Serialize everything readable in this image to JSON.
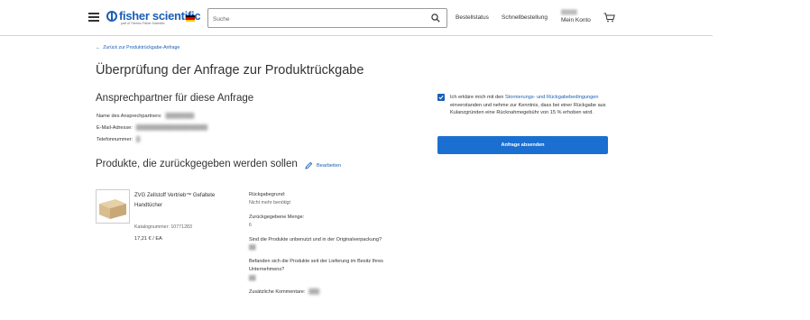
{
  "header": {
    "logo_text": "fisher scientific",
    "logo_sub": "part of Thermo Fisher Scientific",
    "search_placeholder": "Suche",
    "order_status": "Bestellstatus",
    "quick_order": "Schnellbestellung",
    "account_name": "Mein Konto",
    "flag_colors": [
      "#000000",
      "#dd0000",
      "#ffce00"
    ]
  },
  "back_link": "Zurück zur Produktrückgabe-Anfrage",
  "page_title": "Überprüfung der Anfrage zur Produktrückgabe",
  "contact": {
    "heading": "Ansprechpartner für diese Anfrage",
    "name_label": "Name des Ansprechpartners:",
    "email_label": "E-Mail-Adresse:",
    "phone_label": "Telefonnummer:"
  },
  "products": {
    "heading": "Produkte, die zurückgegeben werden sollen",
    "edit_label": "Bearbeiten",
    "item": {
      "name": "ZVG Zellstoff Vertrieb™ Gefaltete Handtücher",
      "catalog": "Katalognummer: 10771283",
      "price": "17,21 € / EA"
    },
    "reason_q": "Rückgabegrund:",
    "reason_a": "Nicht mehr benötigt",
    "qty_q": "Zurückgegebene Menge:",
    "qty_a": "6",
    "unused_q": "Sind die Produkte unbenutzt und in der Originalverpackung?",
    "possession_q": "Befanden sich die Produkte seit der Lieferung im Besitz Ihres Unternehmens?",
    "comments_q": "Zusätzliche Kommentare:"
  },
  "terms": {
    "text_before": "Ich erkläre mich mit den ",
    "link": "Stornierungs- und Rückgabebedingungen",
    "text_after": " einverstanden und nehme zur Kenntnis, dass bei einer Rückgabe aus Kulanzgründen eine Rücknahmegebühr von 15 % erhoben wird."
  },
  "submit_label": "Anfrage absenden",
  "accent_color": "#1a6fd1"
}
